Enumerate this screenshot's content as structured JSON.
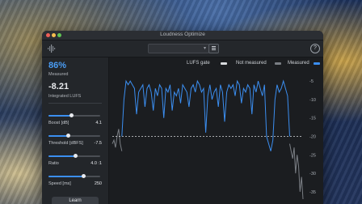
{
  "window": {
    "title": "Loudness Optimize"
  },
  "toolbar": {
    "preset_value": "",
    "help_label": "?"
  },
  "readouts": {
    "measured_percent": "86%",
    "measured_label": "Measured",
    "integrated_value": "-8.21",
    "integrated_label": "Integrated LUFS"
  },
  "controls": {
    "boost": {
      "label": "Boost [dB]",
      "value": "4.1",
      "position": 0.45
    },
    "threshold": {
      "label": "Threshold [dBFS]",
      "value": "-7.5",
      "position": 0.38
    },
    "ratio": {
      "label": "Ratio",
      "value": "4.0 :1",
      "position": 0.52
    },
    "speed": {
      "label": "Speed [ms]",
      "value": "250",
      "position": 0.68
    }
  },
  "learn_button": "Learn",
  "legend": {
    "gate_label": "LUFS gate",
    "not_measured_label": "Not measured",
    "measured_label": "Measured"
  },
  "colors": {
    "measured": "#3b8ef0",
    "not_measured": "#7a7e84",
    "gate": "#d8dadd",
    "accent_text": "#4a9df5"
  },
  "chart_data": {
    "type": "line",
    "y_ticks": [
      "-5",
      "-10",
      "-15",
      "-20",
      "-25",
      "-30",
      "-35"
    ],
    "ylim": [
      -37,
      -3
    ],
    "gate_level": -20,
    "series": [
      {
        "name": "Not measured",
        "values": [
          -22,
          -21,
          -23,
          -20,
          -18,
          -22,
          -24
        ]
      },
      {
        "name": "Measured",
        "values": [
          -20,
          -10,
          -5,
          -6,
          -5,
          -6,
          -7,
          -14,
          -8,
          -7,
          -6,
          -12,
          -7,
          -6,
          -8,
          -13,
          -7,
          -9,
          -6,
          -7,
          -15,
          -7,
          -8,
          -6,
          -13,
          -8,
          -9,
          -7,
          -11,
          -6,
          -7,
          -8,
          -12,
          -7,
          -6,
          -8,
          -5,
          -6,
          -8,
          -7,
          -19,
          -9,
          -6,
          -10,
          -8,
          -7,
          -12,
          -6,
          -8,
          -16,
          -8,
          -6,
          -7,
          -6,
          -9,
          -5,
          -6,
          -11,
          -7,
          -8,
          -6,
          -7,
          -14,
          -6,
          -8,
          -5,
          -7,
          -9,
          -6,
          -20,
          -22,
          -24,
          -21,
          -10,
          -6,
          -8,
          -7,
          -5,
          -7,
          -9,
          -20
        ]
      },
      {
        "name": "Not measured",
        "values": [
          -22,
          -24,
          -26,
          -23,
          -30,
          -25,
          -28,
          -35,
          -31,
          -37
        ]
      }
    ]
  }
}
